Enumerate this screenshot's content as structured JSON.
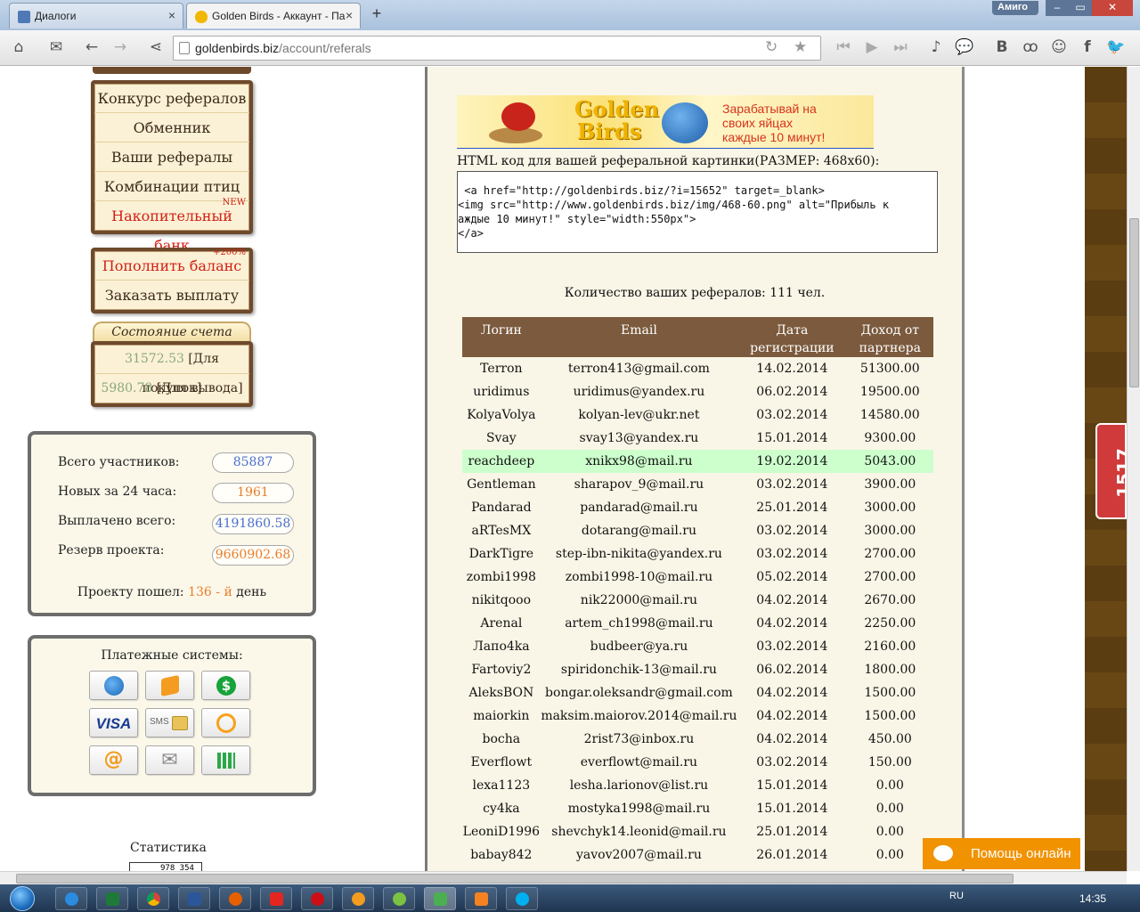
{
  "browser": {
    "tabs": [
      {
        "title": "Диалоги"
      },
      {
        "title": "Golden Birds - Аккаунт - Па"
      }
    ],
    "new_tab": "+",
    "profile": "Амиго",
    "url_domain": "goldenbirds.biz",
    "url_path": "/account/referals",
    "window_controls": {
      "min": "–",
      "max": "▭",
      "close": "✕"
    }
  },
  "menu_main": [
    {
      "label": "Конкурс рефералов"
    },
    {
      "label": "Обменник"
    },
    {
      "label": "Ваши рефералы"
    },
    {
      "label": "Комбинации птиц"
    },
    {
      "label": "Накопительный банк",
      "badge": "NEW"
    }
  ],
  "menu_money": [
    {
      "label": "Пополнить баланс",
      "badge": "+200%"
    },
    {
      "label": "Заказать выплату"
    }
  ],
  "account": {
    "title": "Состояние счета",
    "buy_value": "31572.53",
    "buy_label": "[Для покупок]",
    "withdraw_value": "5980.78",
    "withdraw_label": "[Для вывода]"
  },
  "stats": {
    "total_label": "Всего участников:",
    "total_value": "85887",
    "new_label": "Новых за 24 часа:",
    "new_value": "1961",
    "paid_label": "Выплачено всего:",
    "paid_value": "4191860.58",
    "reserve_label": "Резерв проекта:",
    "reserve_value": "9660902.68",
    "day_prefix": "Проекту пошел:",
    "day_value": "136 - й",
    "day_suffix": "день"
  },
  "payments": {
    "title": "Платежные системы:",
    "visa": "VISA",
    "sms": "SMS"
  },
  "statistics": {
    "title": "Статистика",
    "counter": "978 354"
  },
  "banner": {
    "logo_line1": "Golden",
    "logo_line2": "Birds",
    "slogan": [
      "Зарабатывай на",
      "своих яйцах",
      "каждые 10 минут!"
    ]
  },
  "code": {
    "label": "HTML код для вашей реферальной картинки(РАЗМЕР: 468х60):",
    "text": " <a href=\"http://goldenbirds.biz/?i=15652\" target=_blank>\n<img src=\"http://www.goldenbirds.biz/img/468-60.png\" alt=\"Прибыль к\nаждые 10 минут!\" style=\"width:550px\">\n</a>"
  },
  "referrals": {
    "count_text": "Количество ваших рефералов: 111 чел.",
    "headers": [
      "Логин",
      "Email",
      "Дата регистрации",
      "Доход от партнера"
    ],
    "rows": [
      [
        "Terron",
        "terron413@gmail.com",
        "14.02.2014",
        "51300.00"
      ],
      [
        "uridimus",
        "uridimus@yandex.ru",
        "06.02.2014",
        "19500.00"
      ],
      [
        "KolyaVolya",
        "kolyan-lev@ukr.net",
        "03.02.2014",
        "14580.00"
      ],
      [
        "Svay",
        "svay13@yandex.ru",
        "15.01.2014",
        "9300.00"
      ],
      [
        "reachdeep",
        "xnikx98@mail.ru",
        "19.02.2014",
        "5043.00"
      ],
      [
        "Gentleman",
        "sharapov_9@mail.ru",
        "03.02.2014",
        "3900.00"
      ],
      [
        "Pandarad",
        "pandarad@mail.ru",
        "25.01.2014",
        "3000.00"
      ],
      [
        "aRTesMX",
        "dotarang@mail.ru",
        "03.02.2014",
        "3000.00"
      ],
      [
        "DarkTigre",
        "step-ibn-nikita@yandex.ru",
        "03.02.2014",
        "2700.00"
      ],
      [
        "zombi1998",
        "zombi1998-10@mail.ru",
        "05.02.2014",
        "2700.00"
      ],
      [
        "nikitqooo",
        "nik22000@mail.ru",
        "04.02.2014",
        "2670.00"
      ],
      [
        "Arenal",
        "artem_ch1998@mail.ru",
        "04.02.2014",
        "2250.00"
      ],
      [
        "Лапо4ka",
        "budbeer@ya.ru",
        "03.02.2014",
        "2160.00"
      ],
      [
        "Fartoviy2",
        "spiridonchik-13@mail.ru",
        "06.02.2014",
        "1800.00"
      ],
      [
        "AleksBON",
        "bongar.oleksandr@gmail.com",
        "04.02.2014",
        "1500.00"
      ],
      [
        "maiorkin",
        "maksim.maiorov.2014@mail.ru",
        "04.02.2014",
        "1500.00"
      ],
      [
        "bocha",
        "2rist73@inbox.ru",
        "04.02.2014",
        "450.00"
      ],
      [
        "Everflowt",
        "everflowt@mail.ru",
        "03.02.2014",
        "150.00"
      ],
      [
        "lexa1123",
        "lesha.larionov@list.ru",
        "15.01.2014",
        "0.00"
      ],
      [
        "cy4ka",
        "mostyka1998@mail.ru",
        "15.01.2014",
        "0.00"
      ],
      [
        "LeoniD1996",
        "shevchyk14.leonid@mail.ru",
        "25.01.2014",
        "0.00"
      ],
      [
        "babay842",
        "yavov2007@mail.ru",
        "26.01.2014",
        "0.00"
      ]
    ],
    "highlight_login": "reachdeep"
  },
  "widgets": {
    "counter": "1517",
    "help": "Помощь онлайн"
  },
  "taskbar": {
    "lang": "RU",
    "time": "14:35"
  },
  "colors": {
    "header_brown": "#7b5a3d",
    "highlight_row": "#ccffcc",
    "accent_orange": "#f19200",
    "menu_red": "#d21f14"
  }
}
